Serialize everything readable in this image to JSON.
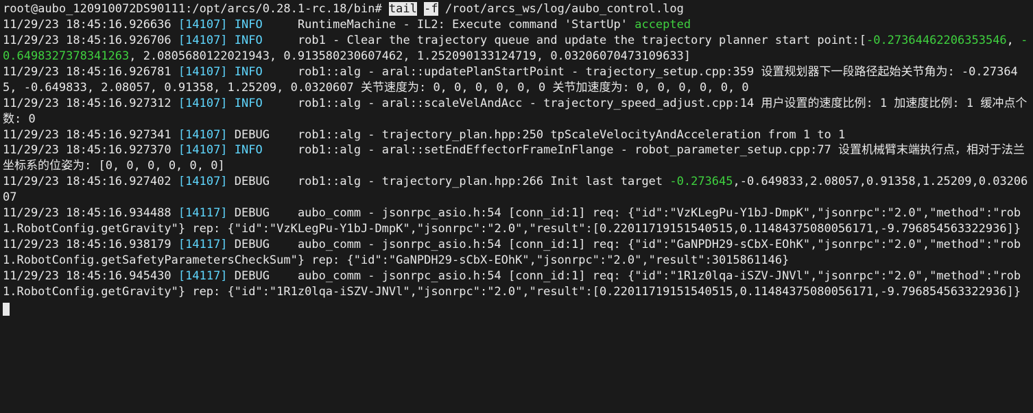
{
  "prompt": {
    "user_host_path": "root@aubo_120910072DS90111:/opt/arcs/0.28.1-rc.18/bin#",
    "cmd_pre": " ",
    "cmd_hl1": "tail",
    "cmd_mid": " ",
    "cmd_hl2": "-f",
    "cmd_post": " /root/arcs_ws/log/aubo_control.log"
  },
  "lines": [
    {
      "ts": "11/29/23 18:45:16.926636",
      "pid": "[14107]",
      "level": "INFO",
      "level_cls": "lvl-info",
      "pad": "     ",
      "msg_pre": "RuntimeMachine - IL2: Execute command 'StartUp' ",
      "msg_green": "accepted",
      "msg_post": ""
    },
    {
      "ts": "11/29/23 18:45:16.926706",
      "pid": "[14107]",
      "level": "INFO",
      "level_cls": "lvl-info",
      "pad": "     ",
      "msg_pre": "rob1 - Clear the trajectory queue and update the trajectory planner start point:[",
      "msg_green": "-0.27364462206353546",
      "msg_post": ", ",
      "tail_green2": "-0.6498327378341263",
      "tail_post2": ", 2.0805680122021943, 0.913580230607462, 1.252090133124719, 0.03206070473109633]"
    },
    {
      "ts": "11/29/23 18:45:16.926781",
      "pid": "[14107]",
      "level": "INFO",
      "level_cls": "lvl-info",
      "pad": "     ",
      "msg_pre": "rob1::alg - aral::updatePlanStartPoint - trajectory_setup.cpp:359 设置规划器下一段路径起始关节角为: -0.273645, -0.649833, 2.08057, 0.91358, 1.25209, 0.0320607 关节速度为: 0, 0, 0, 0, 0, 0 关节加速度为: 0, 0, 0, 0, 0, 0"
    },
    {
      "ts": "11/29/23 18:45:16.927312",
      "pid": "[14107]",
      "level": "INFO",
      "level_cls": "lvl-info",
      "pad": "     ",
      "msg_pre": "rob1::alg - aral::scaleVelAndAcc - trajectory_speed_adjust.cpp:14 用户设置的速度比例: 1 加速度比例: 1 缓冲点个数: 0"
    },
    {
      "ts": "11/29/23 18:45:16.927341",
      "pid": "[14107]",
      "level": "DEBUG",
      "level_cls": "lvl-debug",
      "pad": "    ",
      "msg_pre": "rob1::alg - trajectory_plan.hpp:250 tpScaleVelocityAndAcceleration from 1 to 1"
    },
    {
      "ts": "11/29/23 18:45:16.927370",
      "pid": "[14107]",
      "level": "INFO",
      "level_cls": "lvl-info",
      "pad": "     ",
      "msg_pre": "rob1::alg - aral::setEndEffectorFrameInFlange - robot_parameter_setup.cpp:77 设置机械臂末端执行点，相对于法兰坐标系的位姿为: [0, 0, 0, 0, 0, 0]"
    },
    {
      "ts": "11/29/23 18:45:16.927402",
      "pid": "[14107]",
      "level": "DEBUG",
      "level_cls": "lvl-debug",
      "pad": "    ",
      "msg_pre": "rob1::alg - trajectory_plan.hpp:266 Init last target ",
      "msg_green": "-0.273645",
      "msg_post": ",-0.649833,2.08057,0.91358,1.25209,0.0320607"
    },
    {
      "ts": "11/29/23 18:45:16.934488",
      "pid": "[14117]",
      "level": "DEBUG",
      "level_cls": "lvl-debug",
      "pad": "    ",
      "msg_pre": "aubo_comm - jsonrpc_asio.h:54 [conn_id:1] req: {\"id\":\"VzKLegPu-Y1bJ-DmpK\",\"jsonrpc\":\"2.0\",\"method\":\"rob1.RobotConfig.getGravity\"} rep: {\"id\":\"VzKLegPu-Y1bJ-DmpK\",\"jsonrpc\":\"2.0\",\"result\":[0.22011719151540515,0.11484375080056171,-9.796854563322936]}"
    },
    {
      "ts": "11/29/23 18:45:16.938179",
      "pid": "[14117]",
      "level": "DEBUG",
      "level_cls": "lvl-debug",
      "pad": "    ",
      "msg_pre": "aubo_comm - jsonrpc_asio.h:54 [conn_id:1] req: {\"id\":\"GaNPDH29-sCbX-EOhK\",\"jsonrpc\":\"2.0\",\"method\":\"rob1.RobotConfig.getSafetyParametersCheckSum\"} rep: {\"id\":\"GaNPDH29-sCbX-EOhK\",\"jsonrpc\":\"2.0\",\"result\":3015861146}"
    },
    {
      "ts": "11/29/23 18:45:16.945430",
      "pid": "[14117]",
      "level": "DEBUG",
      "level_cls": "lvl-debug",
      "pad": "    ",
      "msg_pre": "aubo_comm - jsonrpc_asio.h:54 [conn_id:1] req: {\"id\":\"1R1z0lqa-iSZV-JNVl\",\"jsonrpc\":\"2.0\",\"method\":\"rob1.RobotConfig.getGravity\"} rep: {\"id\":\"1R1z0lqa-iSZV-JNVl\",\"jsonrpc\":\"2.0\",\"result\":[0.22011719151540515,0.11484375080056171,-9.796854563322936]}"
    }
  ]
}
